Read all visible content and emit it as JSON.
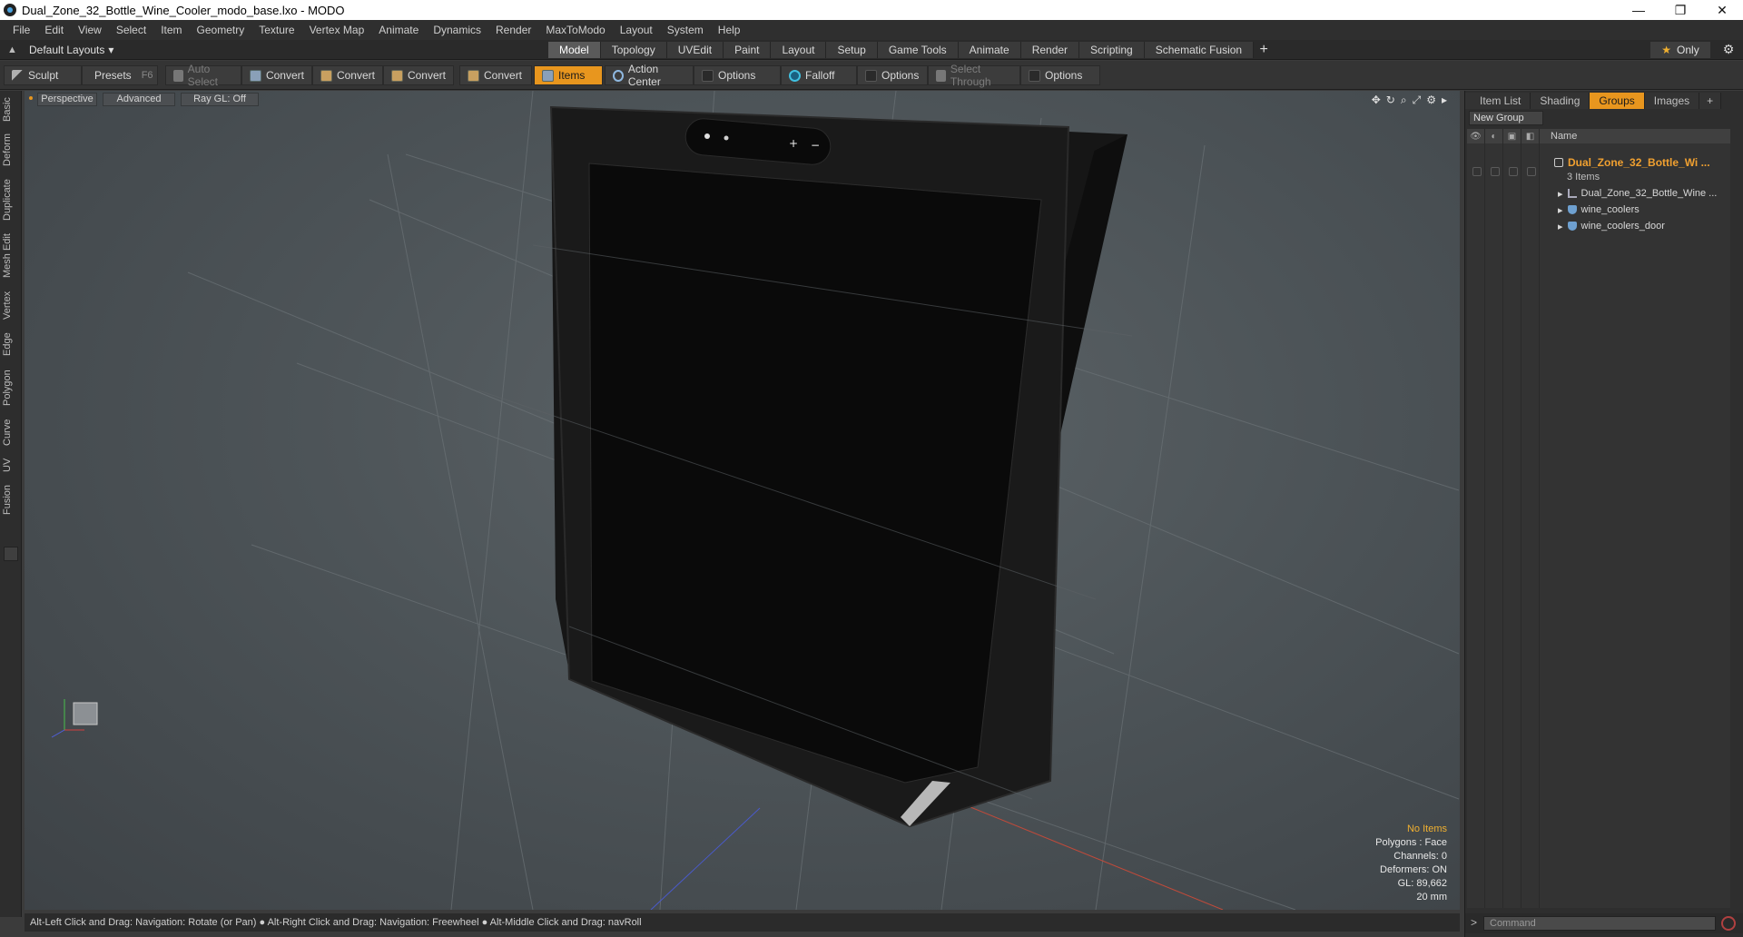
{
  "window": {
    "title": "Dual_Zone_32_Bottle_Wine_Cooler_modo_base.lxo - MODO",
    "controls": [
      "—",
      "❐",
      "✕"
    ]
  },
  "menu": [
    "File",
    "Edit",
    "View",
    "Select",
    "Item",
    "Geometry",
    "Texture",
    "Vertex Map",
    "Animate",
    "Dynamics",
    "Render",
    "MaxToModo",
    "Layout",
    "System",
    "Help"
  ],
  "layoutbar": {
    "layout_dropdown": "Default Layouts",
    "tabs": [
      "Model",
      "Topology",
      "UVEdit",
      "Paint",
      "Layout",
      "Setup",
      "Game Tools",
      "Animate",
      "Render",
      "Scripting",
      "Schematic Fusion"
    ],
    "active_tab": "Model",
    "add_tab": "+",
    "only_label": "Only"
  },
  "toolbar": {
    "sculpt": "Sculpt",
    "presets": "Presets",
    "presets_key": "F6",
    "auto_select": "Auto Select",
    "convert1": "Convert",
    "convert2": "Convert",
    "convert3": "Convert",
    "convert4": "Convert",
    "items": "Items",
    "action_center": "Action Center",
    "options1": "Options",
    "falloff": "Falloff",
    "options2": "Options",
    "select_through": "Select Through",
    "options3": "Options"
  },
  "left_tabs": [
    "Basic",
    "Deform",
    "Duplicate",
    "Mesh Edit",
    "Vertex",
    "Edge",
    "Polygon",
    "Curve",
    "UV",
    "Fusion"
  ],
  "viewport": {
    "view_mode": "Perspective",
    "advanced": "Advanced",
    "raygl": "Ray GL: Off",
    "stats": {
      "no_items": "No Items",
      "polygons": "Polygons : Face",
      "channels": "Channels: 0",
      "deformers": "Deformers: ON",
      "gl": "GL: 89,662",
      "scale": "20 mm"
    },
    "cooler_buttons": [
      "+",
      "−"
    ]
  },
  "status": {
    "hint": "Alt-Left Click and Drag: Navigation: Rotate (or Pan) ● Alt-Right Click and Drag: Navigation: Freewheel ● Alt-Middle Click and Drag: navRoll"
  },
  "right_panel": {
    "tabs": [
      "Item List",
      "Shading",
      "Groups",
      "Images"
    ],
    "active_tab": "Groups",
    "add_tab": "+",
    "new_group": "New Group",
    "name_header": "Name",
    "tree": {
      "group_name": "Dual_Zone_32_Bottle_Wi ...",
      "group_count": "3 Items",
      "children": [
        "Dual_Zone_32_Bottle_Wine ...",
        "wine_coolers",
        "wine_coolers_door"
      ]
    },
    "command_prompt": ">",
    "command_placeholder": "Command"
  },
  "colors": {
    "accent": "#e8961e",
    "group_text": "#f0a030",
    "viewport_bg": "#4d5458"
  },
  "icons": {
    "sculpt": "brush-icon",
    "falloff": "falloff-icon",
    "settings": "gear-icon",
    "star": "star-icon"
  }
}
